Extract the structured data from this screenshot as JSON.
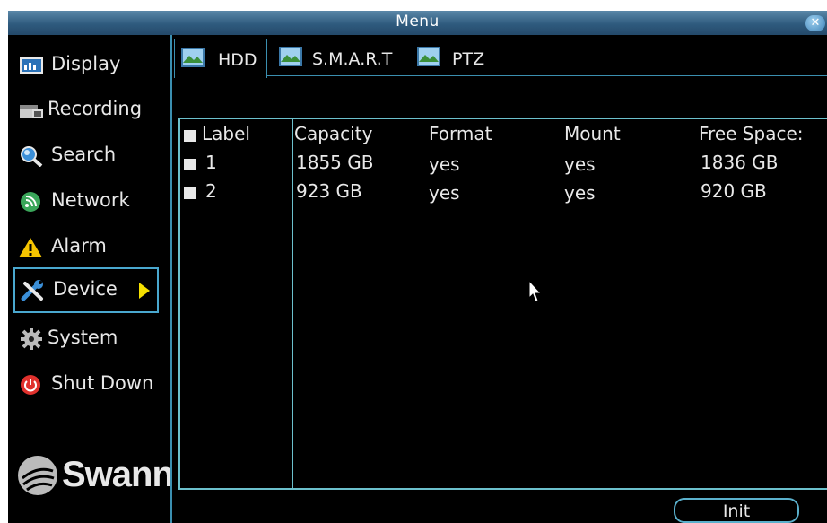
{
  "window": {
    "title": "Menu",
    "close_icon": "close-icon"
  },
  "sidebar": {
    "items": [
      {
        "label": "Display",
        "icon": "display-icon"
      },
      {
        "label": "Recording",
        "icon": "recording-icon"
      },
      {
        "label": "Search",
        "icon": "search-icon"
      },
      {
        "label": "Network",
        "icon": "network-icon"
      },
      {
        "label": "Alarm",
        "icon": "alarm-icon"
      },
      {
        "label": "Device",
        "icon": "device-icon",
        "selected": true
      },
      {
        "label": "System",
        "icon": "system-icon"
      },
      {
        "label": "Shut Down",
        "icon": "power-icon"
      }
    ],
    "logo": "Swann"
  },
  "tabs": [
    {
      "label": "HDD",
      "active": true
    },
    {
      "label": "S.M.A.R.T",
      "active": false
    },
    {
      "label": "PTZ",
      "active": false
    }
  ],
  "table": {
    "headers": [
      "Label",
      "Capacity",
      "Format",
      "Mount",
      "Free Space:"
    ],
    "rows": [
      {
        "label": "1",
        "capacity": "1855 GB",
        "format": "yes",
        "mount": "yes",
        "free": "1836 GB"
      },
      {
        "label": "2",
        "capacity": "923 GB",
        "format": "yes",
        "mount": "yes",
        "free": "920 GB"
      }
    ]
  },
  "buttons": {
    "init": "Init"
  },
  "colors": {
    "accent": "#3b8fb0",
    "table_border": "#6cc0cc",
    "selection_arrow": "#f5e000"
  }
}
